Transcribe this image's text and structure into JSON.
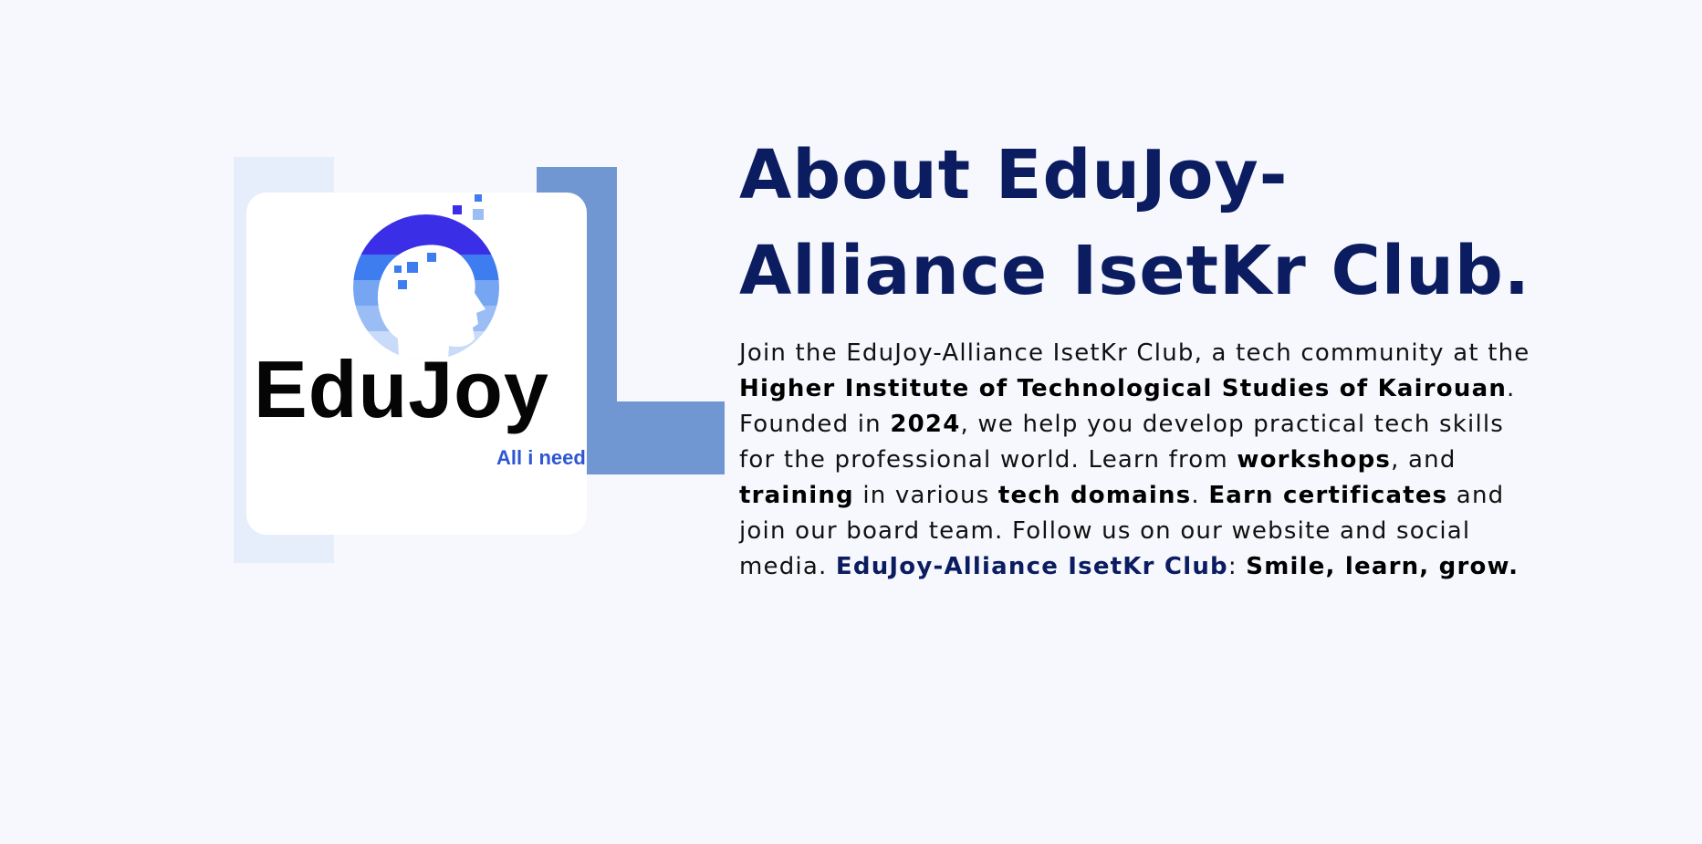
{
  "about": {
    "title_line1": "About EduJoy-",
    "title_line2": "Alliance IsetKr Club.",
    "description": {
      "p1": "Join the EduJoy-Alliance IsetKr Club, a tech community at the ",
      "institute": "Higher Institute of Technological Studies of Kairouan",
      "p2": ". Founded in ",
      "year": "2024",
      "p3": ", we help you develop practical tech skills for the professional world. Learn from ",
      "workshops": "workshops",
      "p4": ", and ",
      "training": "training",
      "p5": " in various ",
      "domains": "tech domains",
      "p6": ". ",
      "certificates": "Earn certificates",
      "p7": " and join our board team. Follow us on our website and social media. ",
      "club_name": "EduJoy-Alliance IsetKr Club",
      "p8": ": ",
      "slogan": "Smile, learn, grow."
    }
  },
  "logo": {
    "wordmark": "EduJoy",
    "tagline": "All i need",
    "icon": "head-pixels-icon"
  },
  "colors": {
    "background": "#f7f8fd",
    "title": "#0b1d60",
    "accent_blue": "#7197d2",
    "light_frame": "#e6eefc",
    "logo_tagline": "#2f55d4"
  }
}
